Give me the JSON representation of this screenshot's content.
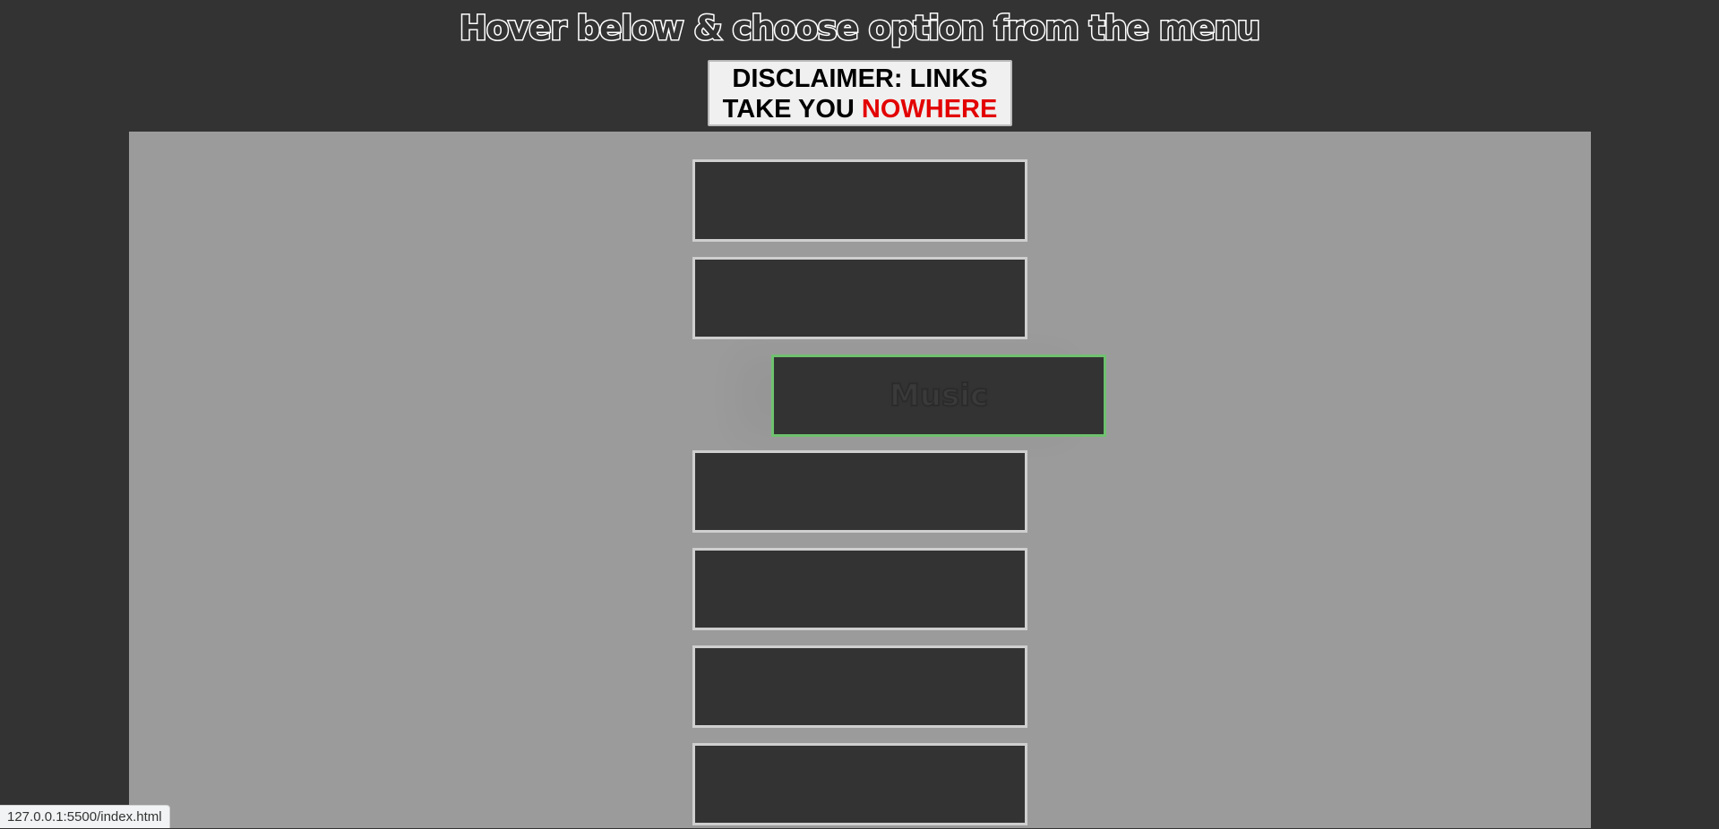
{
  "header": {
    "title": "Hover below & choose option from the menu"
  },
  "disclaimer": {
    "line1": "DISCLAIMER: LINKS",
    "line2_prefix": "TAKE YOU ",
    "line2_highlight": "NOWHERE",
    "highlight_color": "#e30000"
  },
  "menu": {
    "items": [
      {
        "label": "",
        "hovered": false
      },
      {
        "label": "",
        "hovered": false
      },
      {
        "label": "Music",
        "hovered": true
      },
      {
        "label": "",
        "hovered": false
      },
      {
        "label": "",
        "hovered": false
      },
      {
        "label": "",
        "hovered": false
      },
      {
        "label": "",
        "hovered": false
      }
    ],
    "hover_border_color": "#6fc16f"
  },
  "status_bar": {
    "url": "127.0.0.1:5500/index.html"
  },
  "colors": {
    "background": "#333333",
    "panel": "#9b9b9b",
    "item_border": "#cfcfcf"
  }
}
